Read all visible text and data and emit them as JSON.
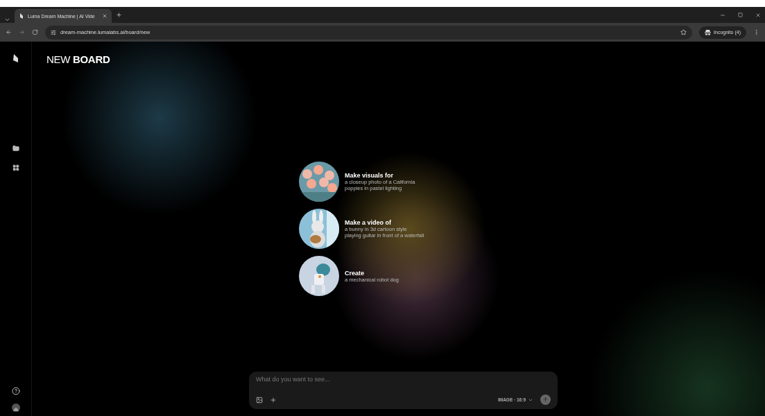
{
  "browser": {
    "tab_title": "Luma Dream Machine | AI Vide",
    "url": "dream-machine.lumalabs.ai/board/new",
    "incognito": "Incognito (4)"
  },
  "page": {
    "title": "NEW **BOARD**"
  },
  "suggestions": [
    {
      "heading": "Make visuals for",
      "lines": [
        "a closeup photo of a California",
        "poppies in pastel lighting"
      ]
    },
    {
      "heading": "Make a video of",
      "lines": [
        "a bunny in 3d cartoon style",
        "playing guitar in front of a waterfall"
      ]
    },
    {
      "heading": "Create",
      "lines": [
        "a mechanical robot dog"
      ]
    }
  ],
  "prompt": {
    "placeholder": "What do you want to see...",
    "mode": "IMAGE · 16:9"
  }
}
